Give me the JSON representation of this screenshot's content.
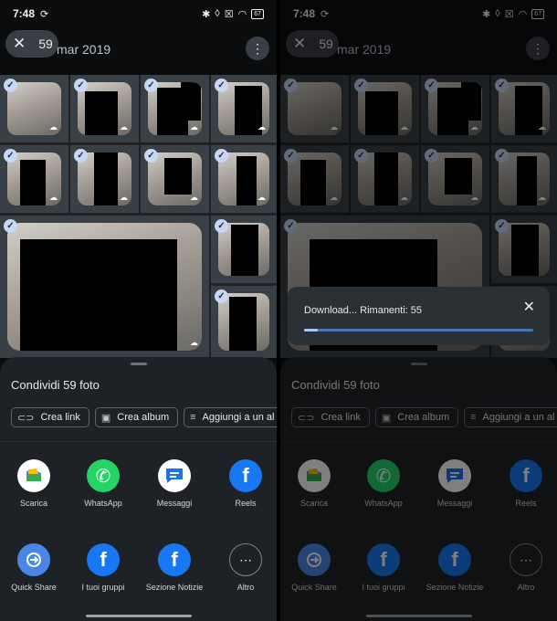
{
  "status": {
    "time": "7:48",
    "battery": "67"
  },
  "header": {
    "selected_count": "59",
    "date_label": "mar 2019"
  },
  "sheet": {
    "title": "Condividi 59 foto",
    "chips": [
      {
        "label": "Crea link",
        "icon": "link-icon"
      },
      {
        "label": "Crea album",
        "icon": "album-icon"
      },
      {
        "label": "Aggiungi a un al",
        "icon": "add-to-list-icon"
      }
    ],
    "apps_row1": [
      {
        "label": "Scarica",
        "icon": "download-folder-icon"
      },
      {
        "label": "WhatsApp",
        "icon": "whatsapp-icon"
      },
      {
        "label": "Messaggi",
        "icon": "messages-icon"
      },
      {
        "label": "Reels",
        "icon": "facebook-icon"
      }
    ],
    "apps_row2": [
      {
        "label": "Quick Share",
        "icon": "quick-share-icon"
      },
      {
        "label": "I tuoi gruppi",
        "icon": "facebook-icon"
      },
      {
        "label": "Sezione Notizie",
        "icon": "facebook-icon"
      },
      {
        "label": "Altro",
        "icon": "more-icon"
      }
    ]
  },
  "download": {
    "text": "Download... Rimanenti: 55",
    "progress": 0.06
  },
  "colors": {
    "accent": "#a8c7fa",
    "sheet_bg": "#1e2226",
    "whatsapp": "#25d366",
    "facebook": "#1877f2"
  }
}
